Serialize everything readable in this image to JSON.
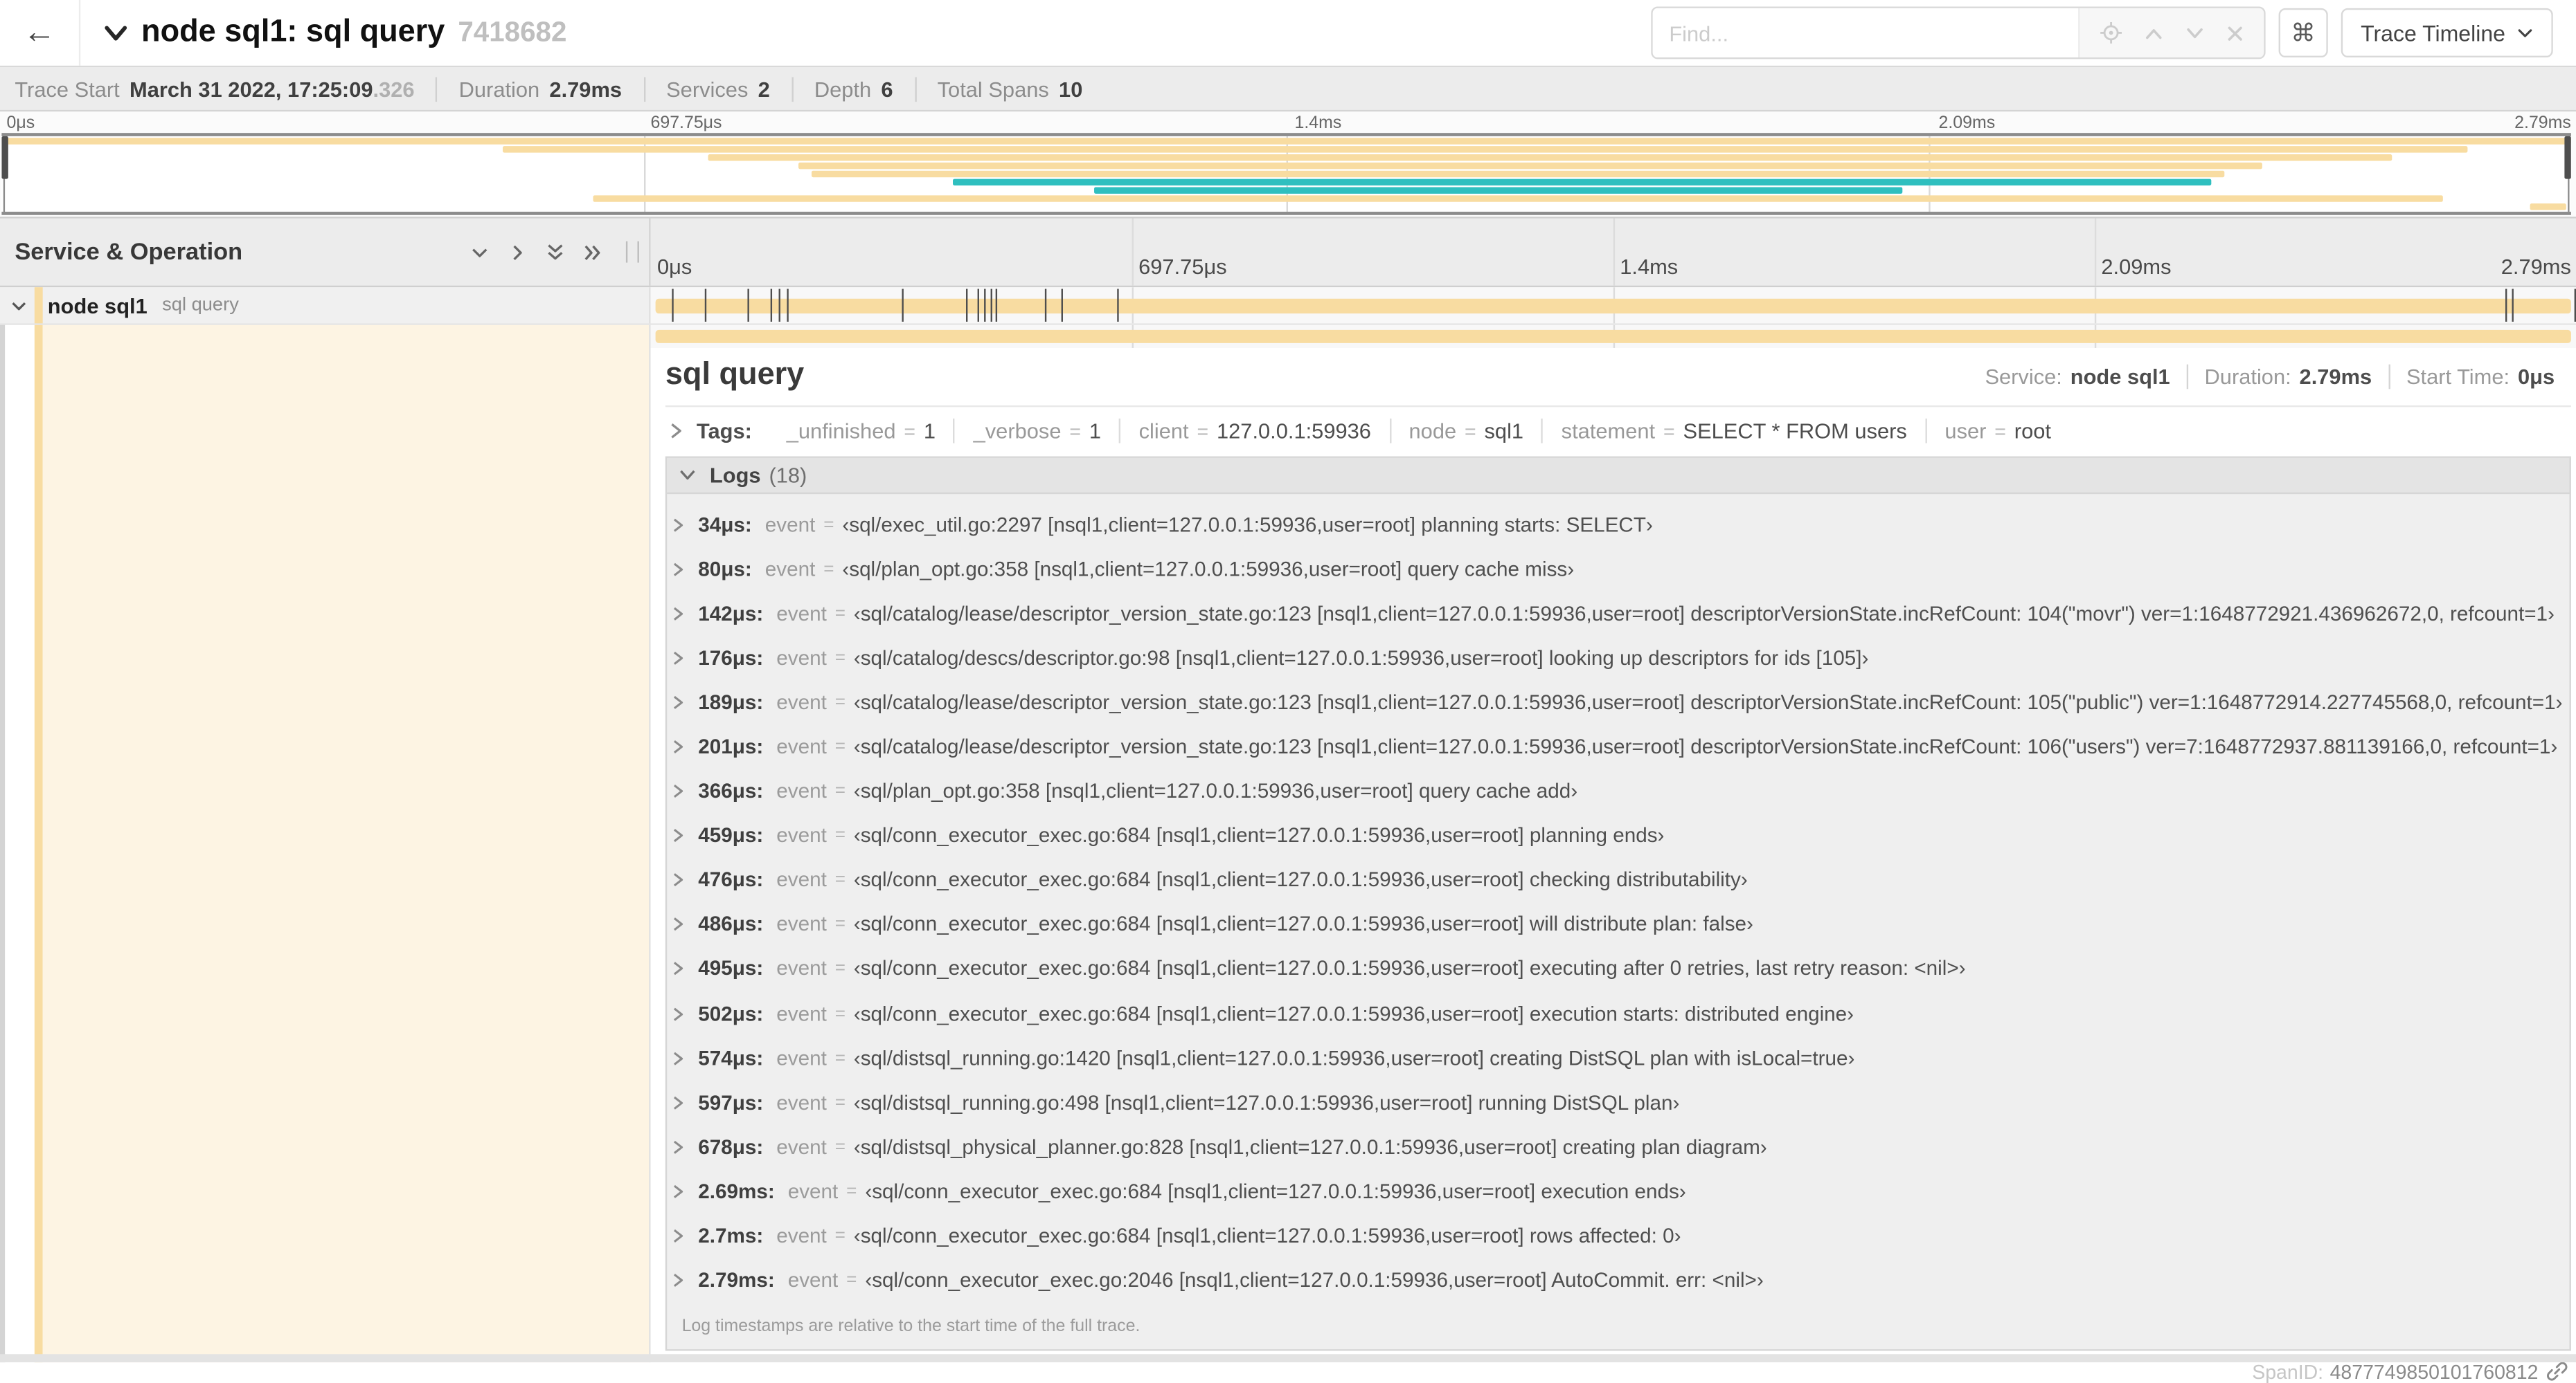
{
  "header": {
    "title": "node sql1: sql query",
    "trace_id": "7418682",
    "find_placeholder": "Find...",
    "shortcut_button_glyph": "⌘",
    "view_selector_label": "Trace Timeline"
  },
  "summary": {
    "items": [
      {
        "label": "Trace Start",
        "value": "March 31 2022, 17:25:09",
        "suffix": ".326"
      },
      {
        "label": "Duration",
        "value": "2.79ms"
      },
      {
        "label": "Services",
        "value": "2"
      },
      {
        "label": "Depth",
        "value": "6"
      },
      {
        "label": "Total Spans",
        "value": "10"
      }
    ]
  },
  "minimap": {
    "ticks": [
      {
        "label": "0μs",
        "pct": 0
      },
      {
        "label": "697.75μs",
        "pct": 25
      },
      {
        "label": "1.4ms",
        "pct": 50
      },
      {
        "label": "2.09ms",
        "pct": 75
      },
      {
        "label": "2.79ms",
        "pct": 100
      }
    ],
    "rows": [
      {
        "start_pct": 0,
        "end_pct": 100,
        "color": "#F8DCA1"
      },
      {
        "start_pct": 19.5,
        "end_pct": 96,
        "color": "#F8DCA1"
      },
      {
        "start_pct": 27.5,
        "end_pct": 93,
        "color": "#F8DCA1"
      },
      {
        "start_pct": 31,
        "end_pct": 88,
        "color": "#F8DCA1"
      },
      {
        "start_pct": 31.5,
        "end_pct": 86.5,
        "color": "#F8DCA1"
      },
      {
        "start_pct": 37,
        "end_pct": 86,
        "color": "#2FBFBF"
      },
      {
        "start_pct": 42.5,
        "end_pct": 74,
        "color": "#2FBFBF"
      },
      {
        "start_pct": 23,
        "end_pct": 95,
        "color": "#F8DCA1"
      },
      {
        "start_pct": 98.4,
        "end_pct": 99.8,
        "color": "#F8DCA1"
      }
    ]
  },
  "timeline": {
    "left_header": "Service & Operation",
    "ticks": [
      {
        "label": "0μs",
        "pct": 0
      },
      {
        "label": "697.75μs",
        "pct": 25
      },
      {
        "label": "1.4ms",
        "pct": 50
      },
      {
        "label": "2.09ms",
        "pct": 75
      },
      {
        "label": "2.79ms",
        "pct": 100
      }
    ],
    "duration_us": 2790,
    "span_row": {
      "service": "node sql1",
      "operation": "sql query",
      "bar_color": "#F8DCA1",
      "log_marker_times_us": [
        34,
        80,
        142,
        176,
        189,
        201,
        366,
        459,
        476,
        486,
        495,
        502,
        574,
        597,
        678,
        2690,
        2700,
        2790
      ]
    }
  },
  "detail": {
    "operation": "sql query",
    "accent_color": "#F8DCA1",
    "meta": [
      {
        "label": "Service:",
        "value": "node sql1"
      },
      {
        "label": "Duration:",
        "value": "2.79ms"
      },
      {
        "label": "Start Time:",
        "value": "0μs"
      }
    ],
    "tags": {
      "label": "Tags:",
      "eq": "=",
      "pairs": [
        {
          "key": "_unfinished",
          "value": "1"
        },
        {
          "key": "_verbose",
          "value": "1"
        },
        {
          "key": "client",
          "value": "127.0.0.1:59936"
        },
        {
          "key": "node",
          "value": "sql1"
        },
        {
          "key": "statement",
          "value": "SELECT * FROM users"
        },
        {
          "key": "user",
          "value": "root"
        }
      ]
    },
    "logs": {
      "label": "Logs",
      "count": "(18)",
      "field_label": "event",
      "eq": "=",
      "entries": [
        {
          "time": "34μs:",
          "value": "‹sql/exec_util.go:2297 [nsql1,client=127.0.0.1:59936,user=root] planning starts: SELECT›"
        },
        {
          "time": "80μs:",
          "value": "‹sql/plan_opt.go:358 [nsql1,client=127.0.0.1:59936,user=root] query cache miss›"
        },
        {
          "time": "142μs:",
          "value": "‹sql/catalog/lease/descriptor_version_state.go:123 [nsql1,client=127.0.0.1:59936,user=root] descriptorVersionState.incRefCount: 104(\"movr\") ver=1:1648772921.436962672,0, refcount=1›"
        },
        {
          "time": "176μs:",
          "value": "‹sql/catalog/descs/descriptor.go:98 [nsql1,client=127.0.0.1:59936,user=root] looking up descriptors for ids [105]›"
        },
        {
          "time": "189μs:",
          "value": "‹sql/catalog/lease/descriptor_version_state.go:123 [nsql1,client=127.0.0.1:59936,user=root] descriptorVersionState.incRefCount: 105(\"public\") ver=1:1648772914.227745568,0, refcount=1›"
        },
        {
          "time": "201μs:",
          "value": "‹sql/catalog/lease/descriptor_version_state.go:123 [nsql1,client=127.0.0.1:59936,user=root] descriptorVersionState.incRefCount: 106(\"users\") ver=7:1648772937.881139166,0, refcount=1›"
        },
        {
          "time": "366μs:",
          "value": "‹sql/plan_opt.go:358 [nsql1,client=127.0.0.1:59936,user=root] query cache add›"
        },
        {
          "time": "459μs:",
          "value": "‹sql/conn_executor_exec.go:684 [nsql1,client=127.0.0.1:59936,user=root] planning ends›"
        },
        {
          "time": "476μs:",
          "value": "‹sql/conn_executor_exec.go:684 [nsql1,client=127.0.0.1:59936,user=root] checking distributability›"
        },
        {
          "time": "486μs:",
          "value": "‹sql/conn_executor_exec.go:684 [nsql1,client=127.0.0.1:59936,user=root] will distribute plan: false›"
        },
        {
          "time": "495μs:",
          "value": "‹sql/conn_executor_exec.go:684 [nsql1,client=127.0.0.1:59936,user=root] executing after 0 retries, last retry reason: <nil>›"
        },
        {
          "time": "502μs:",
          "value": "‹sql/conn_executor_exec.go:684 [nsql1,client=127.0.0.1:59936,user=root] execution starts: distributed engine›"
        },
        {
          "time": "574μs:",
          "value": "‹sql/distsql_running.go:1420 [nsql1,client=127.0.0.1:59936,user=root] creating DistSQL plan with isLocal=true›"
        },
        {
          "time": "597μs:",
          "value": "‹sql/distsql_running.go:498 [nsql1,client=127.0.0.1:59936,user=root] running DistSQL plan›"
        },
        {
          "time": "678μs:",
          "value": "‹sql/distsql_physical_planner.go:828 [nsql1,client=127.0.0.1:59936,user=root] creating plan diagram›"
        },
        {
          "time": "2.69ms:",
          "value": "‹sql/conn_executor_exec.go:684 [nsql1,client=127.0.0.1:59936,user=root] execution ends›"
        },
        {
          "time": "2.7ms:",
          "value": "‹sql/conn_executor_exec.go:684 [nsql1,client=127.0.0.1:59936,user=root] rows affected: 0›"
        },
        {
          "time": "2.79ms:",
          "value": "‹sql/conn_executor_exec.go:2046 [nsql1,client=127.0.0.1:59936,user=root] AutoCommit. err: <nil>›"
        }
      ],
      "footnote": "Log timestamps are relative to the start time of the full trace."
    },
    "span_id_label": "SpanID:",
    "span_id": "4877749850101760812"
  }
}
